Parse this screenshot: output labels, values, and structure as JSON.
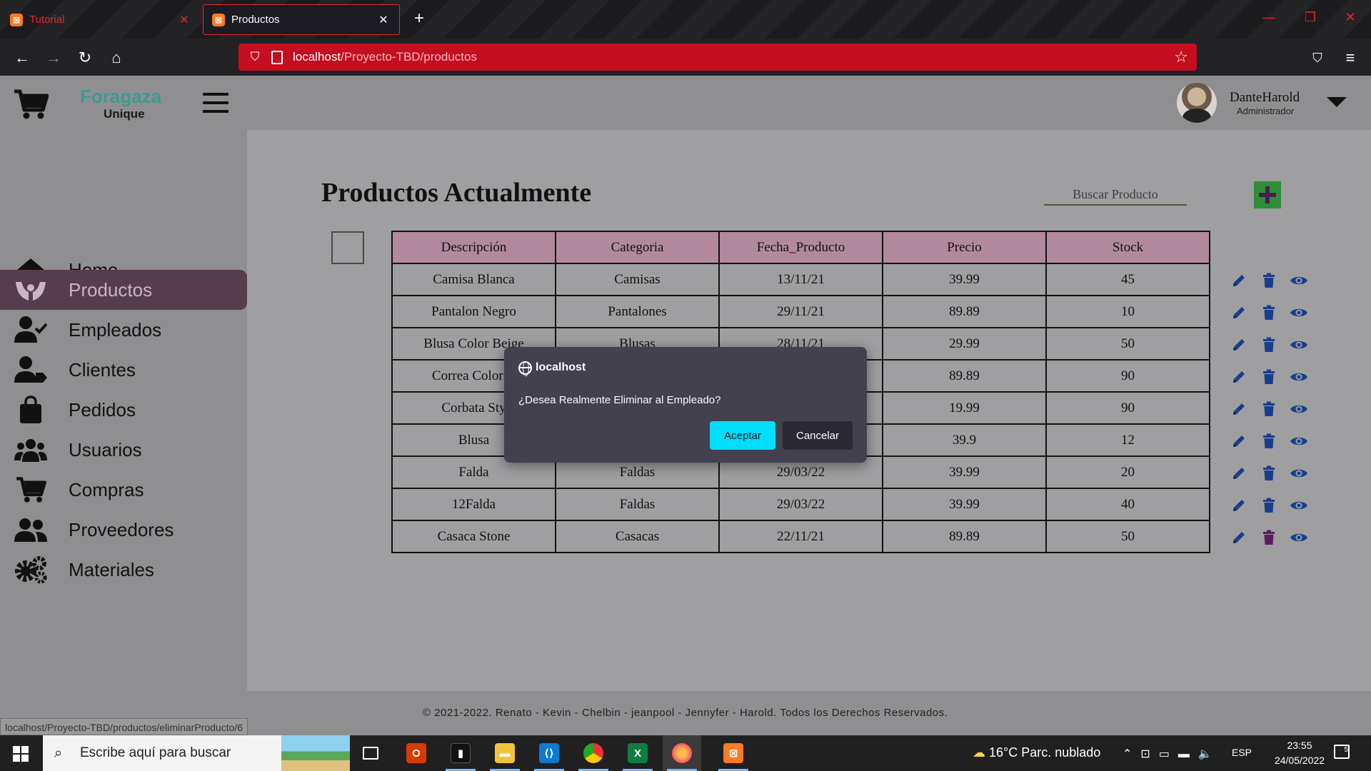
{
  "browser": {
    "tabs": [
      {
        "label": "Tutorial",
        "active": false
      },
      {
        "label": "Productos",
        "active": true
      }
    ],
    "url_host": "localhost",
    "url_path": "/Proyecto-TBD/productos",
    "status_link": "localhost/Proyecto-TBD/productos/eliminarProducto/6",
    "accent": "#e8252e"
  },
  "header": {
    "brand_name": "Foragaza",
    "brand_sub": "Unique",
    "user_name": "DanteHarold",
    "user_role": "Administrador"
  },
  "sidebar": {
    "items": [
      {
        "label": "Home",
        "icon": "home-icon"
      },
      {
        "label": "Productos",
        "icon": "hands-icon",
        "active": true
      },
      {
        "label": "Empleados",
        "icon": "user-check-icon"
      },
      {
        "label": "Clientes",
        "icon": "user-tag-icon"
      },
      {
        "label": "Pedidos",
        "icon": "shopping-bag-icon"
      },
      {
        "label": "Usuarios",
        "icon": "users-icon"
      },
      {
        "label": "Compras",
        "icon": "cart-icon"
      },
      {
        "label": "Proveedores",
        "icon": "user-friends-icon"
      },
      {
        "label": "Materiales",
        "icon": "cogs-icon"
      }
    ]
  },
  "main": {
    "title": "Productos Actualmente",
    "search_placeholder": "Buscar Producto",
    "table": {
      "headers": [
        "Descripción",
        "Categoria",
        "Fecha_Producto",
        "Precio",
        "Stock"
      ],
      "rows": [
        [
          "Camisa Blanca",
          "Camisas",
          "13/11/21",
          "39.99",
          "45"
        ],
        [
          "Pantalon Negro",
          "Pantalones",
          "29/11/21",
          "89.89",
          "10"
        ],
        [
          "Blusa Color Beige",
          "Blusas",
          "28/11/21",
          "29.99",
          "50"
        ],
        [
          "Correa Color C",
          "",
          "",
          "89.89",
          "90"
        ],
        [
          "Corbata Sty",
          "",
          "",
          "19.99",
          "90"
        ],
        [
          "Blusa",
          "",
          "",
          "39.9",
          "12"
        ],
        [
          "Falda",
          "Faldas",
          "29/03/22",
          "39.99",
          "20"
        ],
        [
          "12Falda",
          "Faldas",
          "29/03/22",
          "39.99",
          "40"
        ],
        [
          "Casaca Stone",
          "Casacas",
          "22/11/21",
          "89.89",
          "50"
        ]
      ]
    },
    "action_colors": {
      "edit": "#1a3d8f",
      "delete": "#1a3d8f",
      "delete_highlight": "#5a1e5e",
      "view": "#1a3d8f"
    }
  },
  "footer": {
    "text": "© 2021-2022. Renato - Kevin - Chelbin - jeanpool - Jennyfer - Harold. Todos los Derechos Reservados."
  },
  "dialog": {
    "host": "localhost",
    "message": "¿Desea Realmente Eliminar al Empleado?",
    "ok_label": "Aceptar",
    "cancel_label": "Cancelar"
  },
  "taskbar": {
    "search_placeholder": "Escribe aquí para buscar",
    "weather": "16°C  Parc. nublado",
    "language": "ESP",
    "time": "23:55",
    "date": "24/05/2022",
    "notification_count": "5"
  }
}
